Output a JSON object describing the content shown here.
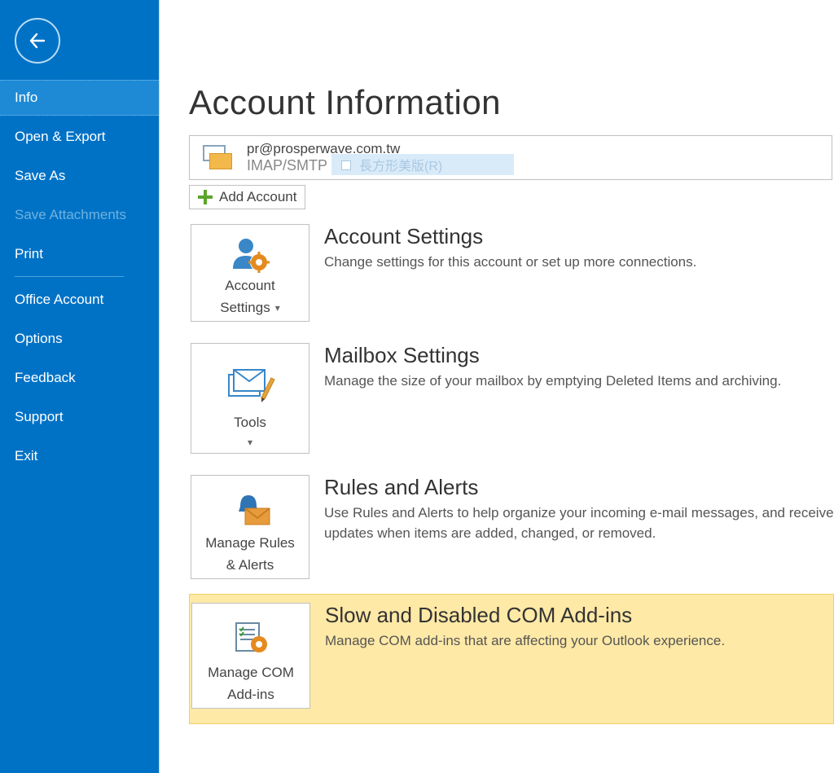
{
  "sidebar": {
    "items": [
      {
        "label": "Info",
        "selected": true,
        "disabled": false
      },
      {
        "label": "Open & Export",
        "selected": false,
        "disabled": false
      },
      {
        "label": "Save As",
        "selected": false,
        "disabled": false
      },
      {
        "label": "Save Attachments",
        "selected": false,
        "disabled": true
      },
      {
        "label": "Print",
        "selected": false,
        "disabled": false
      },
      {
        "label": "Office Account",
        "selected": false,
        "disabled": false
      },
      {
        "label": "Options",
        "selected": false,
        "disabled": false
      },
      {
        "label": "Feedback",
        "selected": false,
        "disabled": false
      },
      {
        "label": "Support",
        "selected": false,
        "disabled": false
      },
      {
        "label": "Exit",
        "selected": false,
        "disabled": false
      }
    ]
  },
  "page": {
    "title": "Account Information"
  },
  "account": {
    "email": "pr@prosperwave.com.tw",
    "protocol": "IMAP/SMTP",
    "hint_overlay": "長方形美版(R)"
  },
  "add_account_label": "Add Account",
  "sections": [
    {
      "tile_label_line1": "Account",
      "tile_label_line2": "Settings",
      "tile_has_dropdown": true,
      "title": "Account Settings",
      "desc": "Change settings for this account or set up more connections."
    },
    {
      "tile_label_line1": "Tools",
      "tile_label_line2": "",
      "tile_has_dropdown": true,
      "title": "Mailbox Settings",
      "desc": "Manage the size of your mailbox by emptying Deleted Items and archiving."
    },
    {
      "tile_label_line1": "Manage Rules",
      "tile_label_line2": "& Alerts",
      "tile_has_dropdown": false,
      "title": "Rules and Alerts",
      "desc": "Use Rules and Alerts to help organize your incoming e-mail messages, and receive updates when items are added, changed, or removed."
    },
    {
      "tile_label_line1": "Manage COM",
      "tile_label_line2": "Add-ins",
      "tile_has_dropdown": false,
      "title": "Slow and Disabled COM Add-ins",
      "desc": "Manage COM add-ins that are affecting your Outlook experience."
    }
  ]
}
